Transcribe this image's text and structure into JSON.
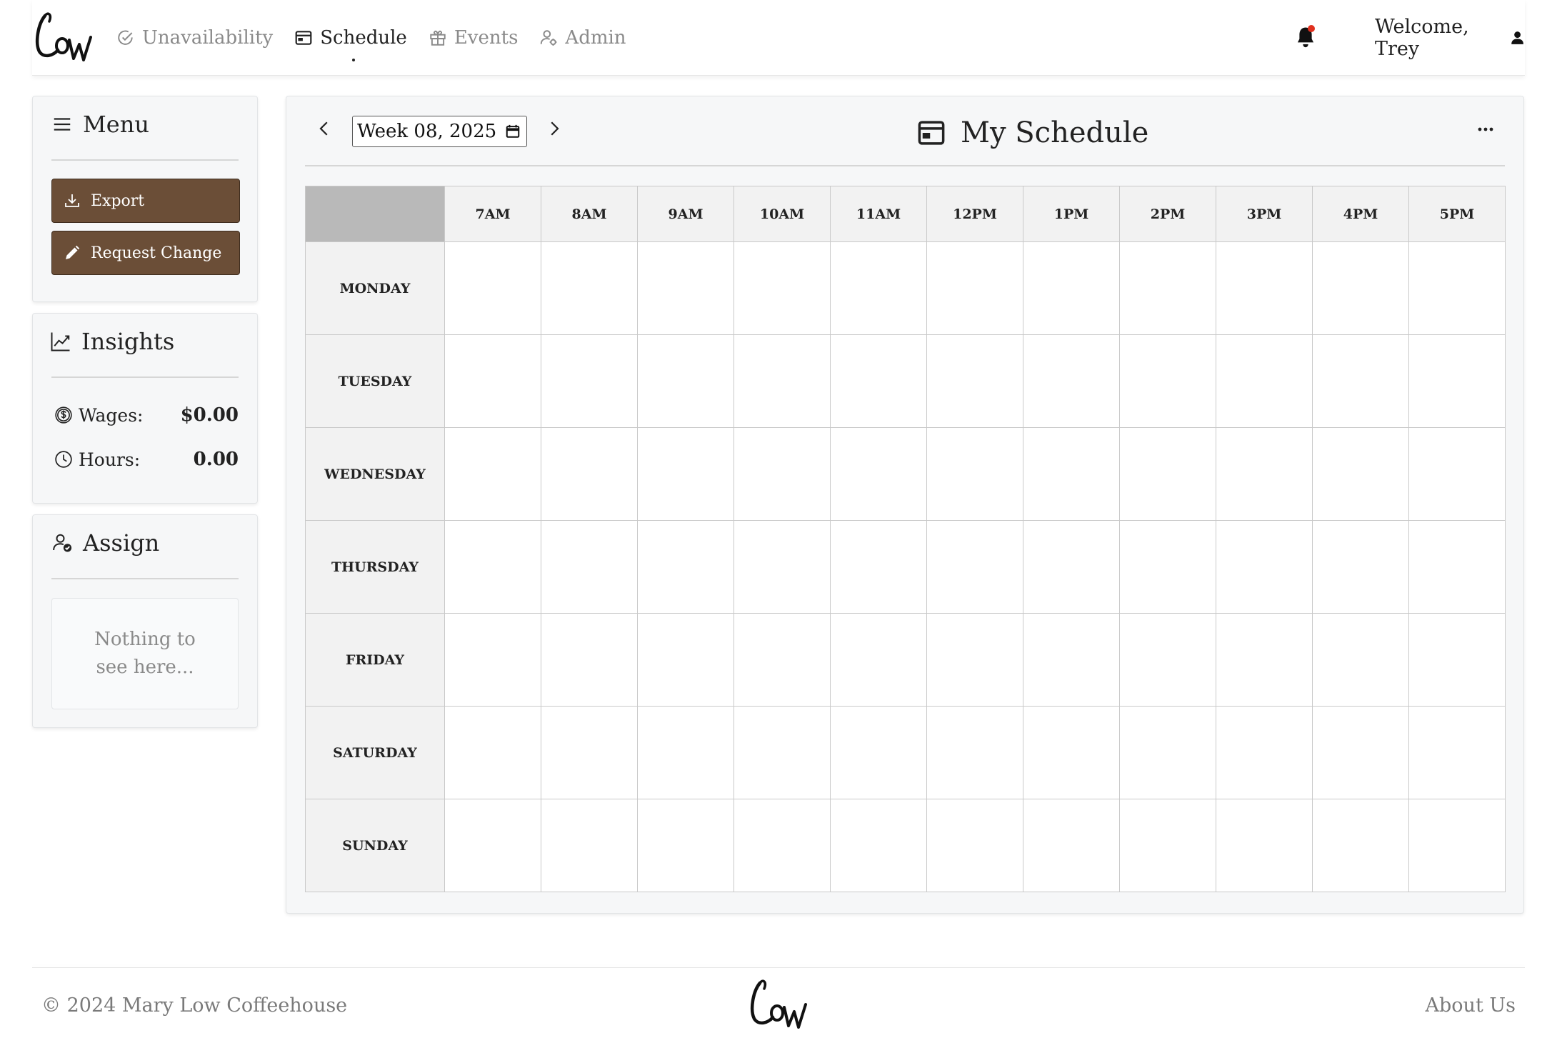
{
  "brand": {
    "logo_text": "Low",
    "icon": "script-logo"
  },
  "nav": {
    "items": [
      {
        "label": "Unavailability",
        "icon": "check-circle-icon",
        "active": false
      },
      {
        "label": "Schedule",
        "icon": "calendar-card-icon",
        "active": true
      },
      {
        "label": "Events",
        "icon": "gift-icon",
        "active": false
      },
      {
        "label": "Admin",
        "icon": "user-gear-icon",
        "active": false
      }
    ]
  },
  "header": {
    "welcome": "Welcome, Trey",
    "notification_icon": "bell-icon",
    "has_notification": true,
    "user_icon": "person-icon"
  },
  "sidebar": {
    "menu": {
      "title": "Menu",
      "icon": "hamburger-icon",
      "buttons": [
        {
          "label": "Export",
          "icon": "download-icon"
        },
        {
          "label": "Request Change",
          "icon": "pencil-icon"
        }
      ]
    },
    "insights": {
      "title": "Insights",
      "icon": "line-chart-icon",
      "stats": [
        {
          "label": "Wages:",
          "value": "$0.00",
          "icon": "dollar-circle-icon"
        },
        {
          "label": "Hours:",
          "value": "0.00",
          "icon": "clock-icon"
        }
      ]
    },
    "assign": {
      "title": "Assign",
      "icon": "user-check-icon",
      "empty_text": "Nothing to see here..."
    }
  },
  "schedule": {
    "title": "My Schedule",
    "title_icon": "calendar-card-icon",
    "week_value": "Week 08, 2025",
    "times": [
      "7AM",
      "8AM",
      "9AM",
      "10AM",
      "11AM",
      "12PM",
      "1PM",
      "2PM",
      "3PM",
      "4PM",
      "5PM"
    ],
    "days": [
      "MONDAY",
      "TUESDAY",
      "WEDNESDAY",
      "THURSDAY",
      "FRIDAY",
      "SATURDAY",
      "SUNDAY"
    ]
  },
  "footer": {
    "copyright": "© 2024 Mary Low Coffeehouse",
    "about": "About Us"
  },
  "colors": {
    "button": "#6b4e37",
    "button_border": "#3e2c1e",
    "notification_dot": "#e0301e",
    "corner_cell": "#b9b9b9",
    "header_cell": "#f2f2f2",
    "panel": "#f6f7f8"
  }
}
